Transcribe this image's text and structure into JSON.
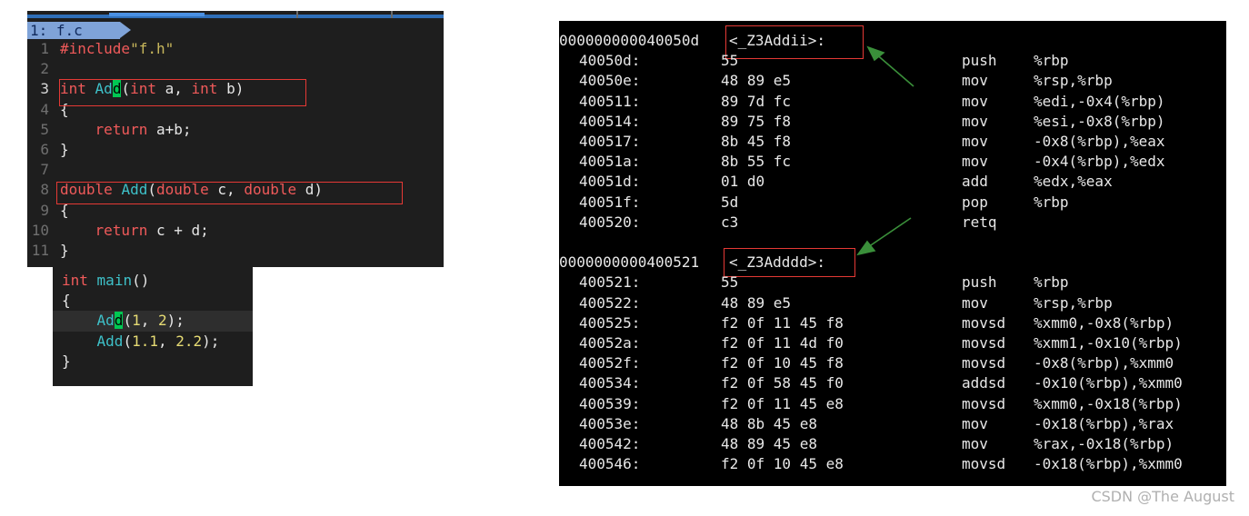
{
  "editor": {
    "tab_label": "1: f.c",
    "lines": [
      {
        "num": "1",
        "tokens": [
          {
            "t": "#include",
            "c": "kw"
          },
          {
            "t": "\"f.h\"",
            "c": "str"
          }
        ]
      },
      {
        "num": "2",
        "tokens": []
      },
      {
        "num": "3",
        "tokens": [
          {
            "t": "int",
            "c": "kw"
          },
          {
            "t": " ",
            "c": "pl"
          },
          {
            "t": "Ad",
            "c": "fn"
          },
          {
            "t": "d",
            "c": "cursor"
          },
          {
            "t": "(",
            "c": "pl"
          },
          {
            "t": "int",
            "c": "kw"
          },
          {
            "t": " a, ",
            "c": "pl"
          },
          {
            "t": "int",
            "c": "kw"
          },
          {
            "t": " b)",
            "c": "pl"
          }
        ]
      },
      {
        "num": "4",
        "tokens": [
          {
            "t": "{",
            "c": "pl"
          }
        ]
      },
      {
        "num": "5",
        "tokens": [
          {
            "t": "    ",
            "c": "pl"
          },
          {
            "t": "return",
            "c": "kw"
          },
          {
            "t": " a+b;",
            "c": "pl"
          }
        ]
      },
      {
        "num": "6",
        "tokens": [
          {
            "t": "}",
            "c": "pl"
          }
        ]
      },
      {
        "num": "7",
        "tokens": []
      },
      {
        "num": "8",
        "tokens": [
          {
            "t": "double",
            "c": "kw"
          },
          {
            "t": " ",
            "c": "pl"
          },
          {
            "t": "Add",
            "c": "fn"
          },
          {
            "t": "(",
            "c": "pl"
          },
          {
            "t": "double",
            "c": "kw"
          },
          {
            "t": " c, ",
            "c": "pl"
          },
          {
            "t": "double",
            "c": "kw"
          },
          {
            "t": " d)",
            "c": "pl"
          }
        ]
      },
      {
        "num": "9",
        "tokens": [
          {
            "t": "{",
            "c": "pl"
          }
        ]
      },
      {
        "num": "10",
        "tokens": [
          {
            "t": "    ",
            "c": "pl"
          },
          {
            "t": "return",
            "c": "kw"
          },
          {
            "t": " c + d;",
            "c": "pl"
          }
        ]
      },
      {
        "num": "11",
        "tokens": [
          {
            "t": "}",
            "c": "pl"
          }
        ]
      }
    ],
    "current_line": "3"
  },
  "main_snippet": {
    "lines": [
      {
        "tokens": [
          {
            "t": "int",
            "c": "kw"
          },
          {
            "t": " ",
            "c": "pl"
          },
          {
            "t": "main",
            "c": "fn"
          },
          {
            "t": "()",
            "c": "pl"
          }
        ]
      },
      {
        "tokens": [
          {
            "t": "{",
            "c": "pl"
          }
        ]
      },
      {
        "tokens": [
          {
            "t": "    ",
            "c": "pl"
          },
          {
            "t": "Ad",
            "c": "fn"
          },
          {
            "t": "d",
            "c": "cursor"
          },
          {
            "t": "(",
            "c": "pl"
          },
          {
            "t": "1",
            "c": "num"
          },
          {
            "t": ", ",
            "c": "pl"
          },
          {
            "t": "2",
            "c": "num"
          },
          {
            "t": ");",
            "c": "pl"
          }
        ]
      },
      {
        "tokens": [
          {
            "t": "    ",
            "c": "pl"
          },
          {
            "t": "Add",
            "c": "fn"
          },
          {
            "t": "(",
            "c": "pl"
          },
          {
            "t": "1.1",
            "c": "num"
          },
          {
            "t": ", ",
            "c": "pl"
          },
          {
            "t": "2.2",
            "c": "num"
          },
          {
            "t": ");",
            "c": "pl"
          }
        ]
      },
      {
        "tokens": [
          {
            "t": "}",
            "c": "pl"
          }
        ]
      }
    ]
  },
  "disasm": {
    "rows": [
      {
        "type": "header",
        "addr": "000000000040050d",
        "label": "<_Z3Addii>:"
      },
      {
        "type": "ins",
        "off": "40050d:",
        "bytes": "55",
        "op": "push",
        "args": "%rbp"
      },
      {
        "type": "ins",
        "off": "40050e:",
        "bytes": "48 89 e5",
        "op": "mov",
        "args": "%rsp,%rbp"
      },
      {
        "type": "ins",
        "off": "400511:",
        "bytes": "89 7d fc",
        "op": "mov",
        "args": "%edi,-0x4(%rbp)"
      },
      {
        "type": "ins",
        "off": "400514:",
        "bytes": "89 75 f8",
        "op": "mov",
        "args": "%esi,-0x8(%rbp)"
      },
      {
        "type": "ins",
        "off": "400517:",
        "bytes": "8b 45 f8",
        "op": "mov",
        "args": "-0x8(%rbp),%eax"
      },
      {
        "type": "ins",
        "off": "40051a:",
        "bytes": "8b 55 fc",
        "op": "mov",
        "args": "-0x4(%rbp),%edx"
      },
      {
        "type": "ins",
        "off": "40051d:",
        "bytes": "01 d0",
        "op": "add",
        "args": "%edx,%eax"
      },
      {
        "type": "ins",
        "off": "40051f:",
        "bytes": "5d",
        "op": "pop",
        "args": "%rbp"
      },
      {
        "type": "ins",
        "off": "400520:",
        "bytes": "c3",
        "op": "retq",
        "args": ""
      },
      {
        "type": "blank"
      },
      {
        "type": "header",
        "addr": "0000000000400521",
        "label": "<_Z3Adddd>:"
      },
      {
        "type": "ins",
        "off": "400521:",
        "bytes": "55",
        "op": "push",
        "args": "%rbp"
      },
      {
        "type": "ins",
        "off": "400522:",
        "bytes": "48 89 e5",
        "op": "mov",
        "args": "%rsp,%rbp"
      },
      {
        "type": "ins",
        "off": "400525:",
        "bytes": "f2 0f 11 45 f8",
        "op": "movsd",
        "args": "%xmm0,-0x8(%rbp)"
      },
      {
        "type": "ins",
        "off": "40052a:",
        "bytes": "f2 0f 11 4d f0",
        "op": "movsd",
        "args": "%xmm1,-0x10(%rbp)"
      },
      {
        "type": "ins",
        "off": "40052f:",
        "bytes": "f2 0f 10 45 f8",
        "op": "movsd",
        "args": "-0x8(%rbp),%xmm0"
      },
      {
        "type": "ins",
        "off": "400534:",
        "bytes": "f2 0f 58 45 f0",
        "op": "addsd",
        "args": "-0x10(%rbp),%xmm0"
      },
      {
        "type": "ins",
        "off": "400539:",
        "bytes": "f2 0f 11 45 e8",
        "op": "movsd",
        "args": "%xmm0,-0x18(%rbp)"
      },
      {
        "type": "ins",
        "off": "40053e:",
        "bytes": "48 8b 45 e8",
        "op": "mov",
        "args": "-0x18(%rbp),%rax"
      },
      {
        "type": "ins",
        "off": "400542:",
        "bytes": "48 89 45 e8",
        "op": "mov",
        "args": "%rax,-0x18(%rbp)"
      },
      {
        "type": "ins",
        "off": "400546:",
        "bytes": "f2 0f 10 45 e8",
        "op": "movsd",
        "args": "-0x18(%rbp),%xmm0"
      }
    ]
  },
  "colors": {
    "highlight_box": "#e53935",
    "arrow": "#3a8f3a",
    "keyword": "#f05a5a",
    "function": "#3ec1c9",
    "cursor": "#00c853"
  },
  "watermark": "CSDN @The   August"
}
